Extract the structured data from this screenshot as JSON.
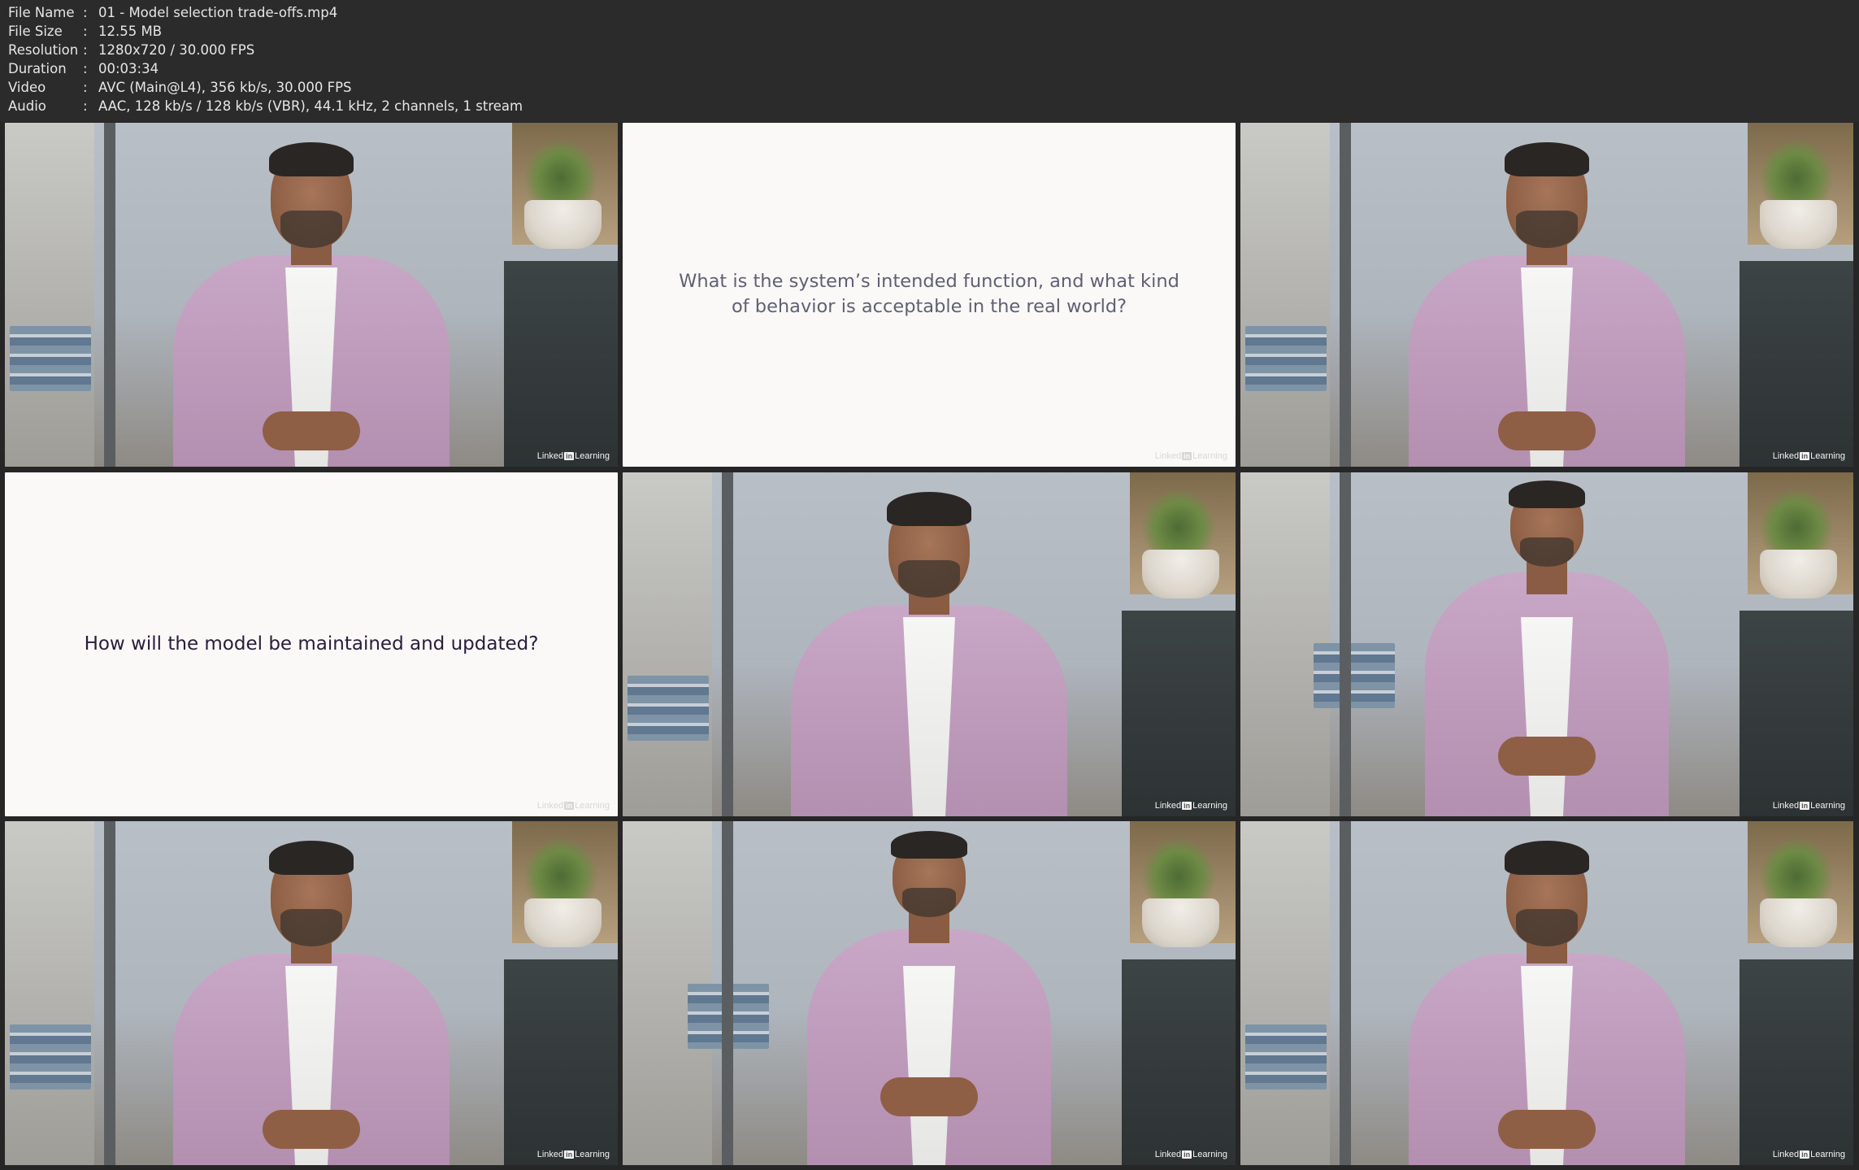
{
  "info": [
    {
      "label": "File Name",
      "value": "01 - Model selection trade-offs.mp4"
    },
    {
      "label": "File Size",
      "value": "12.55 MB"
    },
    {
      "label": "Resolution",
      "value": "1280x720 / 30.000 FPS"
    },
    {
      "label": "Duration",
      "value": "00:03:34"
    },
    {
      "label": "Video",
      "value": "AVC (Main@L4), 356 kb/s, 30.000 FPS"
    },
    {
      "label": "Audio",
      "value": "AAC, 128 kb/s / 128 kb/s (VBR), 44.1 kHz, 2 channels, 1 stream"
    }
  ],
  "separator": ":",
  "watermark": {
    "left": "Linked",
    "badge": "in",
    "right": "Learning"
  },
  "slides": {
    "q1_line1": "What is the system’s intended function, and what kind",
    "q1_line2": "of behavior is acceptable in the real world?",
    "q2": "How will the model be maintained and updated?"
  },
  "colors": {
    "background": "#262626",
    "slide": "#faf9f7",
    "jacket": "#c9a7c6"
  }
}
